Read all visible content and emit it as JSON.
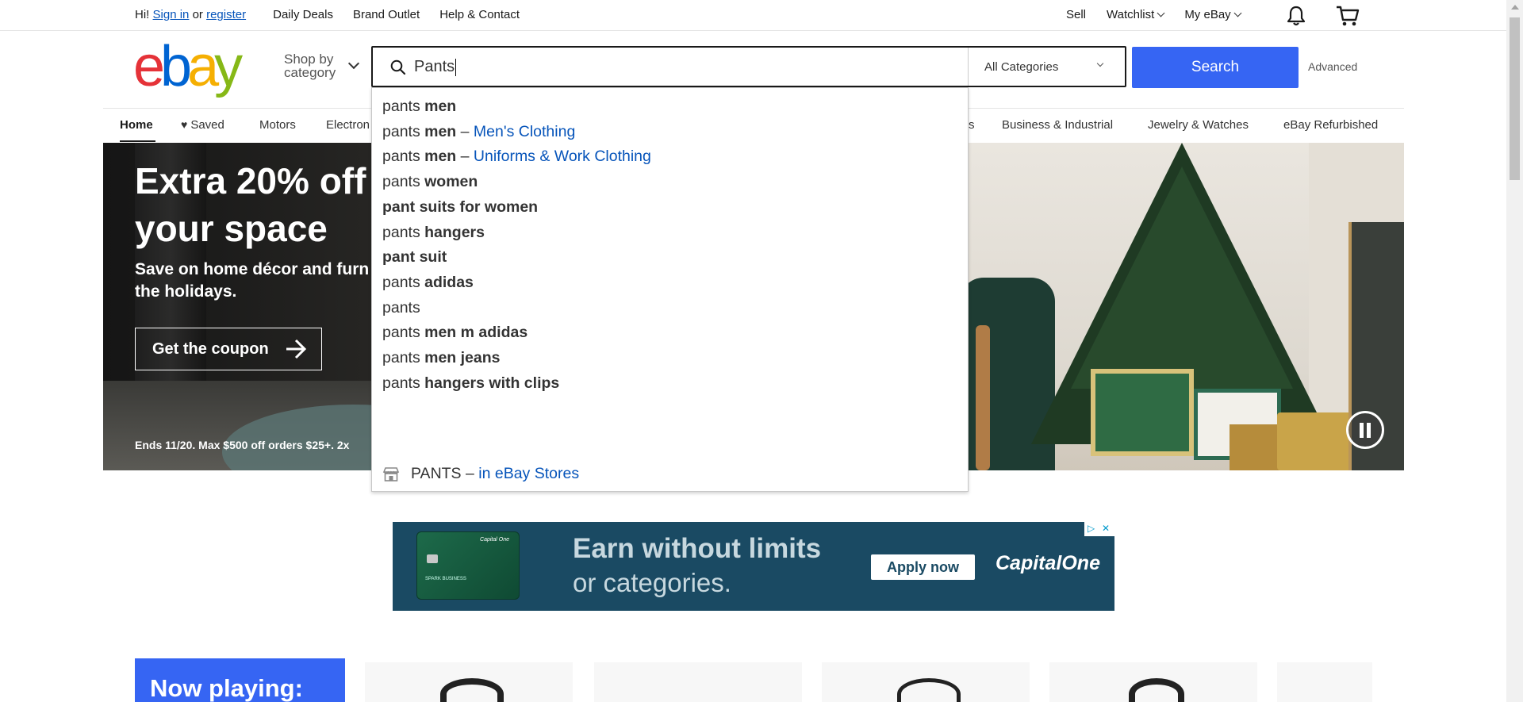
{
  "topbar": {
    "greeting_prefix": "Hi!",
    "sign_in": "Sign in",
    "or": "or",
    "register": "register",
    "daily_deals": "Daily Deals",
    "brand_outlet": "Brand Outlet",
    "help_contact": "Help & Contact",
    "sell": "Sell",
    "watchlist": "Watchlist",
    "my_ebay": "My eBay"
  },
  "header": {
    "logo_letters": [
      "e",
      "b",
      "a",
      "y"
    ],
    "logo_colors": [
      "#e53238",
      "#0064d2",
      "#f5af02",
      "#86b817"
    ],
    "shop_by_line1": "Shop by",
    "shop_by_line2": "category",
    "search_value": "Pants",
    "category_selected": "All Categories",
    "search_button": "Search",
    "advanced": "Advanced"
  },
  "nav": {
    "home": "Home",
    "saved": "Saved",
    "motors": "Motors",
    "electronics": "Electron",
    "hidden_suffix": "s",
    "business": "Business & Industrial",
    "jewelry": "Jewelry & Watches",
    "refurbished": "eBay Refurbished"
  },
  "hero": {
    "headline_line1": "Extra 20% off",
    "headline_line2": "your space",
    "sub_line1": "Save on home décor and furn",
    "sub_line2": "the holidays.",
    "cta": "Get the coupon",
    "fine_print": "Ends 11/20. Max $500 off orders $25+. 2x"
  },
  "autocomplete": {
    "suggestions": [
      {
        "plain": "pants ",
        "bold": "men",
        "sep": "",
        "category": ""
      },
      {
        "plain": "pants ",
        "bold": "men",
        "sep": " – ",
        "category": "Men's Clothing"
      },
      {
        "plain": "pants ",
        "bold": "men",
        "sep": " – ",
        "category": "Uniforms & Work Clothing"
      },
      {
        "plain": "pants ",
        "bold": "women",
        "sep": "",
        "category": ""
      },
      {
        "plain": "",
        "bold": "pant suits for women",
        "sep": "",
        "category": ""
      },
      {
        "plain": "pants ",
        "bold": "hangers",
        "sep": "",
        "category": ""
      },
      {
        "plain": "",
        "bold": "pant suit",
        "sep": "",
        "category": ""
      },
      {
        "plain": "pants ",
        "bold": "adidas",
        "sep": "",
        "category": ""
      },
      {
        "plain": "pants",
        "bold": "",
        "sep": "",
        "category": ""
      },
      {
        "plain": "pants ",
        "bold": "men m adidas",
        "sep": "",
        "category": ""
      },
      {
        "plain": "pants ",
        "bold": "men jeans",
        "sep": "",
        "category": ""
      },
      {
        "plain": "pants ",
        "bold": "hangers with clips",
        "sep": "",
        "category": ""
      }
    ],
    "store_label": "PANTS",
    "store_sep": " – ",
    "store_link": "in eBay Stores"
  },
  "ad": {
    "headline1": "Earn without limits",
    "headline2": "or categories.",
    "button": "Apply now",
    "brand": "CapitalOne",
    "card_brand": "Capital One",
    "card_text": "SPARK BUSINESS"
  },
  "bottom": {
    "now_playing": "Now playing:"
  }
}
